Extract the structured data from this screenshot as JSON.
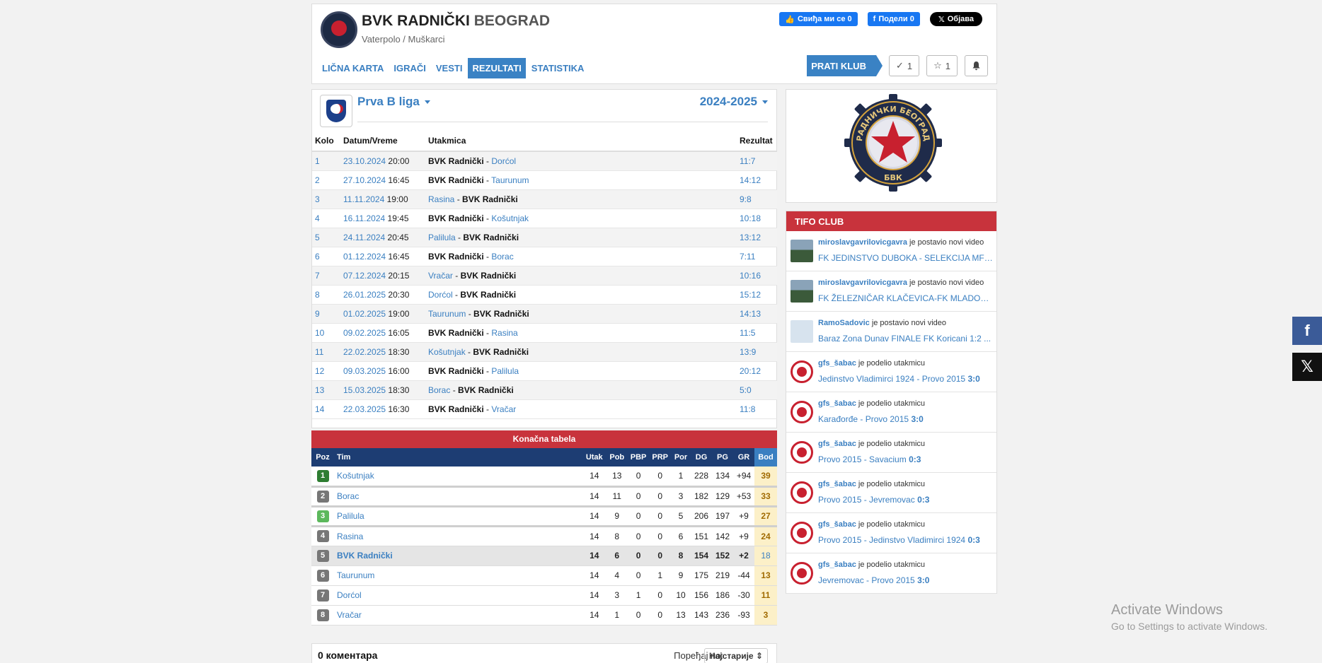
{
  "header": {
    "club_name": "BVK RADNIČKI",
    "club_city": "BEOGRAD",
    "subtitle": "Vaterpolo / Muškarci",
    "social": {
      "like": "Свиђа ми се 0",
      "share": "Подели 0",
      "post": "Објава"
    },
    "nav": [
      {
        "label": "LIČNA KARTA",
        "active": false
      },
      {
        "label": "IGRAČI",
        "active": false
      },
      {
        "label": "VESTI",
        "active": false
      },
      {
        "label": "REZULTATI",
        "active": true
      },
      {
        "label": "STATISTIKA",
        "active": false
      }
    ],
    "follow_label": "PRATI KLUB",
    "check_count": "1",
    "star_count": "1"
  },
  "league": {
    "name": "Prva B liga",
    "season": "2024-2025"
  },
  "matches": {
    "headers": {
      "round": "Kolo",
      "datetime": "Datum/Vreme",
      "match": "Utakmica",
      "result": "Rezultat"
    },
    "rows": [
      {
        "round": "1",
        "date": "23.10.2024",
        "time": "20:00",
        "home": "BVK Radnički",
        "away": "Dorćol",
        "home_bold": true,
        "result": "11:7"
      },
      {
        "round": "2",
        "date": "27.10.2024",
        "time": "16:45",
        "home": "BVK Radnički",
        "away": "Taurunum",
        "home_bold": true,
        "result": "14:12"
      },
      {
        "round": "3",
        "date": "11.11.2024",
        "time": "19:00",
        "home": "Rasina",
        "away": "BVK Radnički",
        "home_bold": false,
        "result": "9:8"
      },
      {
        "round": "4",
        "date": "16.11.2024",
        "time": "19:45",
        "home": "BVK Radnički",
        "away": "Košutnjak",
        "home_bold": true,
        "result": "10:18"
      },
      {
        "round": "5",
        "date": "24.11.2024",
        "time": "20:45",
        "home": "Palilula",
        "away": "BVK Radnički",
        "home_bold": false,
        "result": "13:12"
      },
      {
        "round": "6",
        "date": "01.12.2024",
        "time": "16:45",
        "home": "BVK Radnički",
        "away": "Borac",
        "home_bold": true,
        "result": "7:11"
      },
      {
        "round": "7",
        "date": "07.12.2024",
        "time": "20:15",
        "home": "Vračar",
        "away": "BVK Radnički",
        "home_bold": false,
        "result": "10:16"
      },
      {
        "round": "8",
        "date": "26.01.2025",
        "time": "20:30",
        "home": "Dorćol",
        "away": "BVK Radnički",
        "home_bold": false,
        "result": "15:12"
      },
      {
        "round": "9",
        "date": "01.02.2025",
        "time": "19:00",
        "home": "Taurunum",
        "away": "BVK Radnički",
        "home_bold": false,
        "result": "14:13"
      },
      {
        "round": "10",
        "date": "09.02.2025",
        "time": "16:05",
        "home": "BVK Radnički",
        "away": "Rasina",
        "home_bold": true,
        "result": "11:5"
      },
      {
        "round": "11",
        "date": "22.02.2025",
        "time": "18:30",
        "home": "Košutnjak",
        "away": "BVK Radnički",
        "home_bold": false,
        "result": "13:9"
      },
      {
        "round": "12",
        "date": "09.03.2025",
        "time": "16:00",
        "home": "BVK Radnički",
        "away": "Palilula",
        "home_bold": true,
        "result": "20:12"
      },
      {
        "round": "13",
        "date": "15.03.2025",
        "time": "18:30",
        "home": "Borac",
        "away": "BVK Radnički",
        "home_bold": false,
        "result": "5:0"
      },
      {
        "round": "14",
        "date": "22.03.2025",
        "time": "16:30",
        "home": "BVK Radnički",
        "away": "Vračar",
        "home_bold": true,
        "result": "11:8"
      }
    ]
  },
  "standings": {
    "title": "Konačna tabela",
    "headers": [
      "Poz",
      "Tim",
      "Utak",
      "Pob",
      "PBP",
      "PRP",
      "Por",
      "DG",
      "PG",
      "GR",
      "Bod"
    ],
    "rows": [
      {
        "pos": "1",
        "team": "Košutnjak",
        "utak": "14",
        "pob": "13",
        "pbp": "0",
        "prp": "0",
        "por": "1",
        "dg": "228",
        "pg": "134",
        "gr": "+94",
        "bod": "39",
        "badge": "dark",
        "sep": true,
        "highlight": false
      },
      {
        "pos": "2",
        "team": "Borac",
        "utak": "14",
        "pob": "11",
        "pbp": "0",
        "prp": "0",
        "por": "3",
        "dg": "182",
        "pg": "129",
        "gr": "+53",
        "bod": "33",
        "badge": "grey",
        "sep": true,
        "highlight": false
      },
      {
        "pos": "3",
        "team": "Palilula",
        "utak": "14",
        "pob": "9",
        "pbp": "0",
        "prp": "0",
        "por": "5",
        "dg": "206",
        "pg": "197",
        "gr": "+9",
        "bod": "27",
        "badge": "light",
        "sep": true,
        "highlight": false
      },
      {
        "pos": "4",
        "team": "Rasina",
        "utak": "14",
        "pob": "8",
        "pbp": "0",
        "prp": "0",
        "por": "6",
        "dg": "151",
        "pg": "142",
        "gr": "+9",
        "bod": "24",
        "badge": "grey",
        "sep": false,
        "highlight": false
      },
      {
        "pos": "5",
        "team": "BVK Radnički",
        "utak": "14",
        "pob": "6",
        "pbp": "0",
        "prp": "0",
        "por": "8",
        "dg": "154",
        "pg": "152",
        "gr": "+2",
        "bod": "18",
        "badge": "grey",
        "sep": false,
        "highlight": true
      },
      {
        "pos": "6",
        "team": "Taurunum",
        "utak": "14",
        "pob": "4",
        "pbp": "0",
        "prp": "1",
        "por": "9",
        "dg": "175",
        "pg": "219",
        "gr": "-44",
        "bod": "13",
        "badge": "grey",
        "sep": false,
        "highlight": false
      },
      {
        "pos": "7",
        "team": "Dorćol",
        "utak": "14",
        "pob": "3",
        "pbp": "1",
        "prp": "0",
        "por": "10",
        "dg": "156",
        "pg": "186",
        "gr": "-30",
        "bod": "11",
        "badge": "grey",
        "sep": false,
        "highlight": false
      },
      {
        "pos": "8",
        "team": "Vračar",
        "utak": "14",
        "pob": "1",
        "pbp": "0",
        "prp": "0",
        "por": "13",
        "dg": "143",
        "pg": "236",
        "gr": "-93",
        "bod": "3",
        "badge": "grey",
        "sep": false,
        "highlight": false
      }
    ]
  },
  "comments": {
    "count": "0 коментара",
    "sort_label": "Поређај по:",
    "sort_value": "Најстарије"
  },
  "logo": {
    "top_text": "РАДНИЧКИ БЕОГРАД",
    "bottom_text": "БВК"
  },
  "tifo": {
    "title": "TIFO CLUB",
    "items": [
      {
        "user": "miroslavgavrilovicgavra",
        "action": "je postavio novi video",
        "text": "FK JEDINSTVO DUBOKA - SELEKCIJA MFL S...",
        "score": "",
        "avatar": "photo"
      },
      {
        "user": "miroslavgavrilovicgavra",
        "action": "je postavio novi video",
        "text": "FK ŽELEZNIČAR KLAČEVICA-FK MLADOST G...",
        "score": "",
        "avatar": "photo"
      },
      {
        "user": "RamoSadovic",
        "action": "je postavio novi video",
        "text": "Baraz Zona Dunav FINALE FK Koricani 1:2 ...",
        "score": "",
        "avatar": "blank"
      },
      {
        "user": "gfs_šabac",
        "action": "je podelio utakmicu",
        "text": "Jedinstvo Vladimirci 1924 - Provo 2015",
        "score": "3:0",
        "avatar": "badge"
      },
      {
        "user": "gfs_šabac",
        "action": "je podelio utakmicu",
        "text": "Karađorđe - Provo 2015",
        "score": "3:0",
        "avatar": "badge"
      },
      {
        "user": "gfs_šabac",
        "action": "je podelio utakmicu",
        "text": "Provo 2015 - Savacium",
        "score": "0:3",
        "avatar": "badge"
      },
      {
        "user": "gfs_šabac",
        "action": "je podelio utakmicu",
        "text": "Provo 2015 - Jevremovac",
        "score": "0:3",
        "avatar": "badge"
      },
      {
        "user": "gfs_šabac",
        "action": "je podelio utakmicu",
        "text": "Provo 2015 - Jedinstvo Vladimirci 1924",
        "score": "0:3",
        "avatar": "badge"
      },
      {
        "user": "gfs_šabac",
        "action": "je podelio utakmicu",
        "text": "Jevremovac - Provo 2015",
        "score": "3:0",
        "avatar": "badge"
      }
    ]
  },
  "activate": {
    "title": "Activate Windows",
    "subtitle": "Go to Settings to activate Windows."
  },
  "colors": {
    "accent": "#3a7fc1",
    "red": "#c8333c",
    "navy": "#1d3d73",
    "points_bg": "#fcf0c8"
  }
}
